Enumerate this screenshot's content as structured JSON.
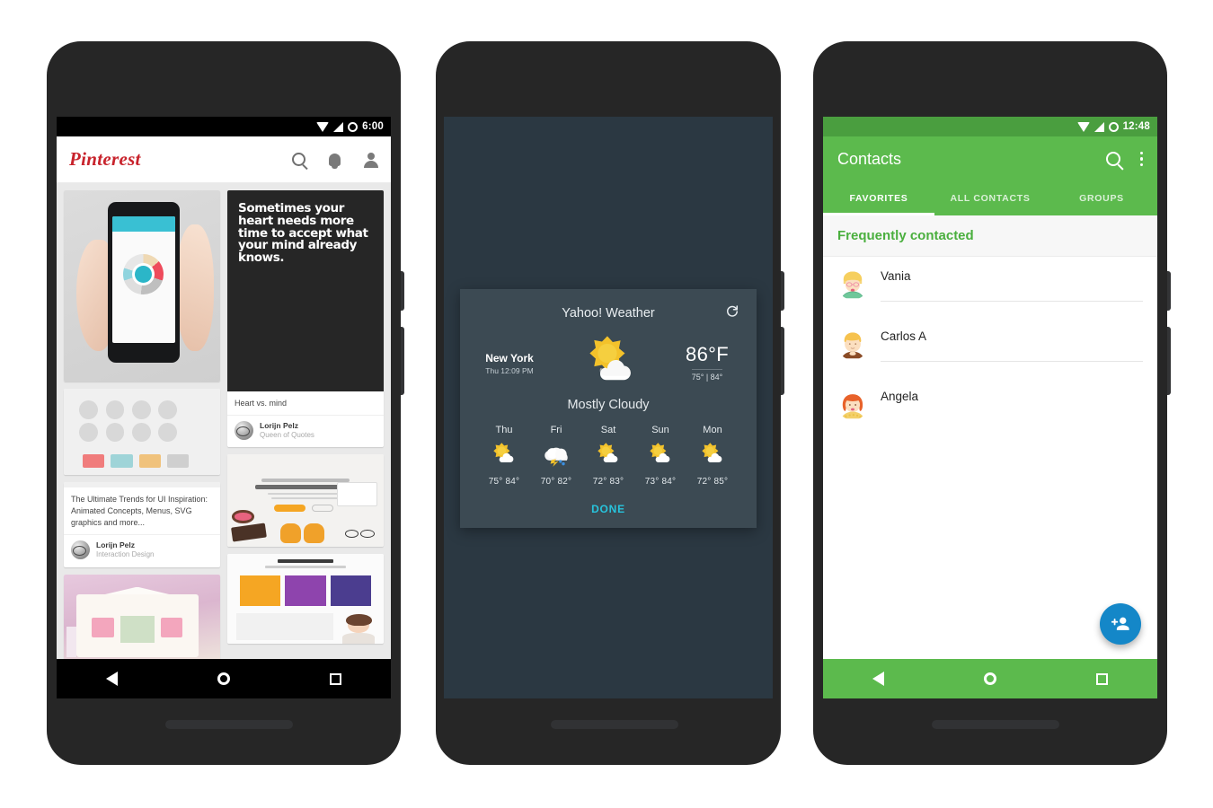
{
  "scene": {
    "background": "#ffffff",
    "phone_count": 3
  },
  "phone1": {
    "name": "pinterest-phone",
    "statusbar": {
      "time": "6:00",
      "icons": [
        "wifi-icon",
        "signal-icon",
        "ring-icon"
      ]
    },
    "appbar": {
      "logo": "Pinterest",
      "logo_color": "#c8232c",
      "actions": [
        "search-icon",
        "notifications-bell-icon",
        "profile-person-icon"
      ]
    },
    "feed": {
      "background": "#e9e9e9",
      "left_column": [
        {
          "art": "hand-holding-phone",
          "title": "",
          "user": "",
          "subtitle": ""
        },
        {
          "art": "ui-kit-mockup",
          "title": "",
          "user": "",
          "subtitle": ""
        },
        {
          "art": "ui-kit-mockup-2",
          "title": "The Ultimate Trends for UI Inspiration: Animated Concepts, Menus, SVG graphics and more...",
          "user": "Lorijn Pelz",
          "subtitle": "Interaction Design"
        },
        {
          "art": "pink-bedroom",
          "title": "",
          "user": "",
          "subtitle": ""
        }
      ],
      "right_column": [
        {
          "art": "black-quote-card",
          "quote": "Sometimes your heart needs more time to accept what your mind already knows.",
          "title": "Heart vs. mind",
          "user": "Lorijn Pelz",
          "subtitle": "Queen of Quotes"
        },
        {
          "art": "web-design-shoes",
          "title": "",
          "user": "",
          "subtitle": ""
        },
        {
          "art": "about-us-webpage",
          "title": "",
          "user": "",
          "subtitle": ""
        }
      ]
    },
    "navbar": {
      "items": [
        "back-icon",
        "home-icon",
        "recents-icon"
      ],
      "background": "#000000"
    }
  },
  "phone2": {
    "name": "weather-phone",
    "screen_background": "#2b3842",
    "dialog": {
      "background": "#3c4a53",
      "title": "Yahoo! Weather",
      "refresh_icon": "refresh-icon",
      "city": "New York",
      "timestamp": "Thu 12:09 PM",
      "current_icon": "sun-behind-cloud-icon",
      "temperature": "86°F",
      "high_low": "75° | 84°",
      "condition": "Mostly Cloudy",
      "forecast": [
        {
          "day": "Thu",
          "icon": "sun-behind-cloud-icon",
          "temps": "75° 84°"
        },
        {
          "day": "Fri",
          "icon": "thunderstorm-rain-icon",
          "temps": "70° 82°"
        },
        {
          "day": "Sat",
          "icon": "sun-behind-cloud-icon",
          "temps": "72° 83°"
        },
        {
          "day": "Sun",
          "icon": "sun-behind-cloud-icon",
          "temps": "73° 84°"
        },
        {
          "day": "Mon",
          "icon": "sun-behind-cloud-icon",
          "temps": "72° 85°"
        }
      ],
      "done_label": "DONE",
      "done_color": "#27c4dd"
    }
  },
  "phone3": {
    "name": "contacts-phone",
    "statusbar": {
      "time": "12:48",
      "background": "#4a9e3f",
      "icons": [
        "wifi-icon",
        "signal-icon",
        "ring-icon"
      ]
    },
    "appbar": {
      "title": "Contacts",
      "background": "#5cba4d",
      "actions": [
        "search-icon",
        "overflow-menu-icon"
      ]
    },
    "tabs": [
      {
        "label": "FAVORITES",
        "active": true
      },
      {
        "label": "ALL CONTACTS",
        "active": false
      },
      {
        "label": "GROUPS",
        "active": false
      }
    ],
    "section_header": "Frequently contacted",
    "section_header_color": "#4aaf3e",
    "contacts": [
      {
        "name": "Vania",
        "avatar": "avatar-blonde-glasses"
      },
      {
        "name": "Carlos A",
        "avatar": "avatar-man-brown-shirt"
      },
      {
        "name": "Angela",
        "avatar": "avatar-redhead-woman"
      }
    ],
    "fab": {
      "icon": "add-person-icon",
      "color": "#1487c8"
    },
    "navbar": {
      "items": [
        "back-icon",
        "home-icon",
        "recents-icon"
      ],
      "background": "#5cba4d"
    }
  }
}
